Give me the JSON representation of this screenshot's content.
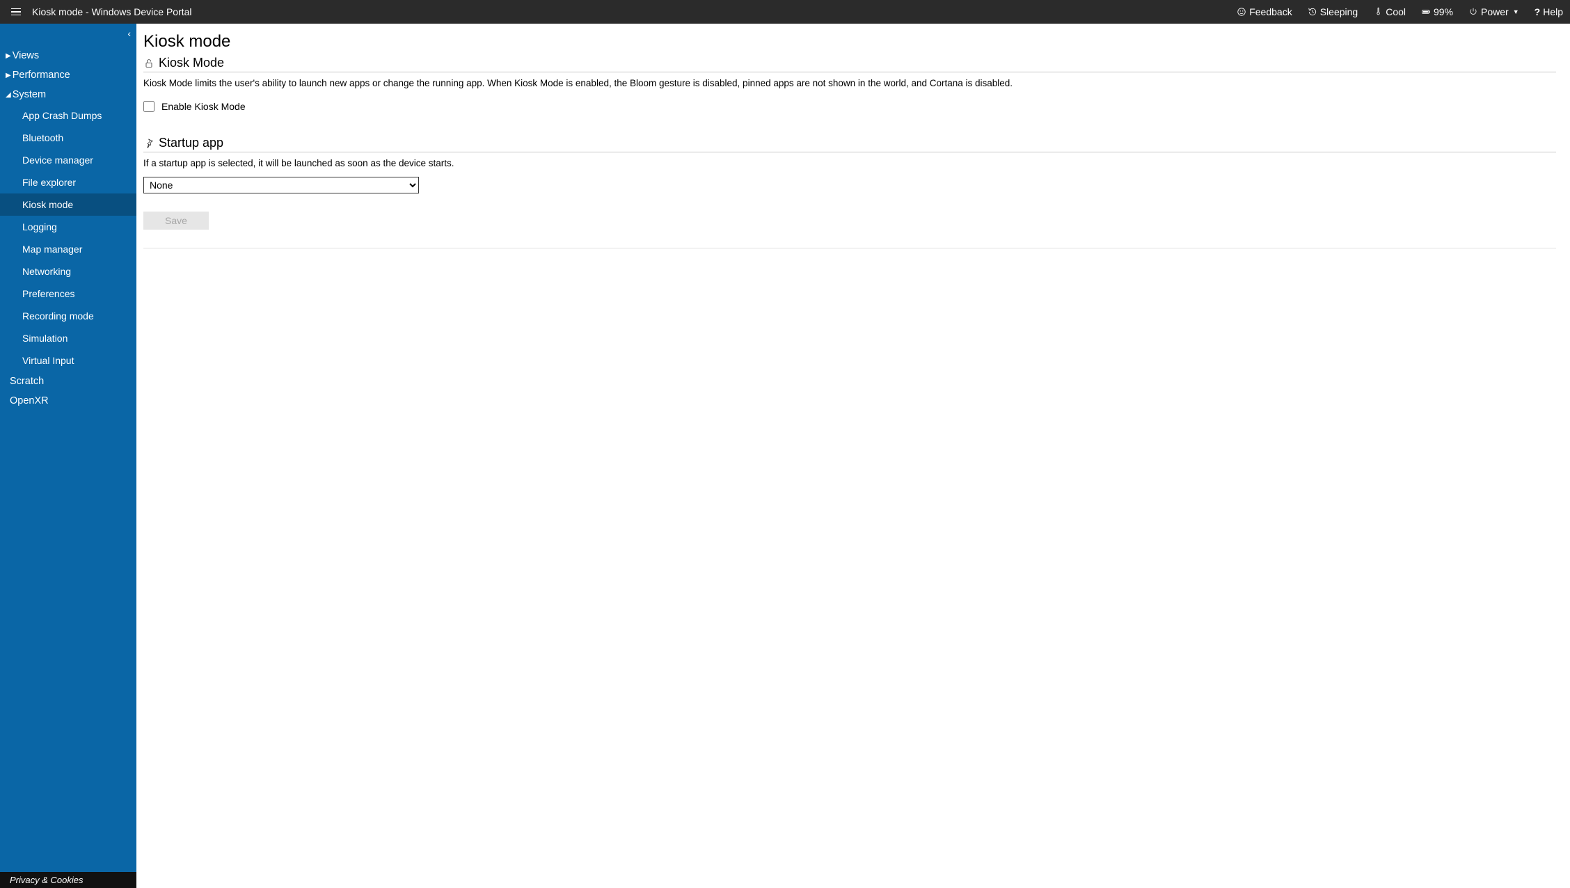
{
  "header": {
    "title": "Kiosk mode - Windows Device Portal",
    "feedback": "Feedback",
    "sleeping": "Sleeping",
    "cool": "Cool",
    "battery": "99%",
    "power": "Power",
    "help": "Help"
  },
  "sidebar": {
    "groups": [
      {
        "label": "Views",
        "expanded": false
      },
      {
        "label": "Performance",
        "expanded": false
      }
    ],
    "system_label": "System",
    "system_items": [
      "App Crash Dumps",
      "Bluetooth",
      "Device manager",
      "File explorer",
      "Kiosk mode",
      "Logging",
      "Map manager",
      "Networking",
      "Preferences",
      "Recording mode",
      "Simulation",
      "Virtual Input"
    ],
    "loose_items": [
      "Scratch",
      "OpenXR"
    ],
    "footer": "Privacy & Cookies"
  },
  "main": {
    "page_title": "Kiosk mode",
    "kiosk_section_title": "Kiosk Mode",
    "kiosk_desc": "Kiosk Mode limits the user's ability to launch new apps or change the running app. When Kiosk Mode is enabled, the Bloom gesture is disabled, pinned apps are not shown in the world, and Cortana is disabled.",
    "enable_label": "Enable Kiosk Mode",
    "startup_section_title": "Startup app",
    "startup_desc": "If a startup app is selected, it will be launched as soon as the device starts.",
    "startup_selected": "None",
    "save_label": "Save"
  }
}
